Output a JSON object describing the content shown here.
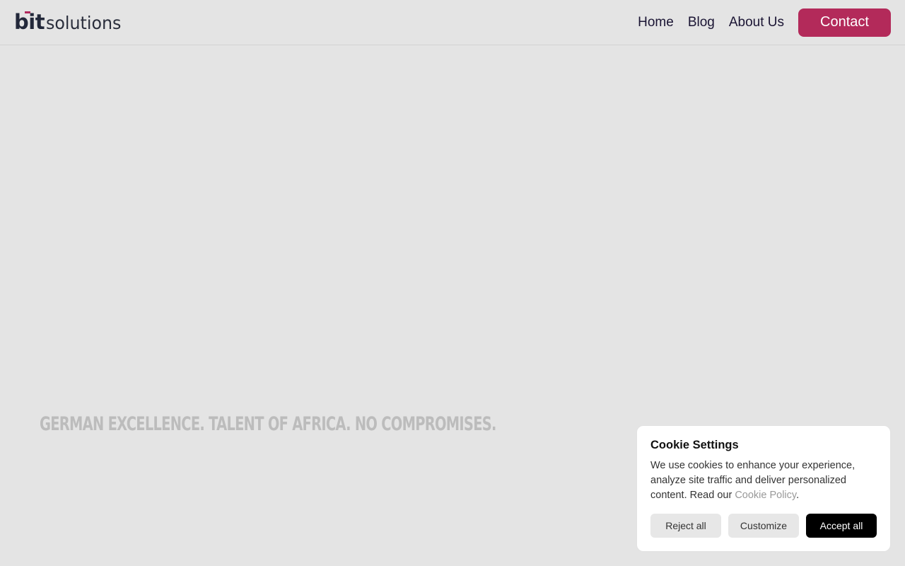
{
  "header": {
    "logo": {
      "bit": "bit",
      "solutions": "solutions"
    },
    "nav": [
      {
        "label": "Home"
      },
      {
        "label": "Blog"
      },
      {
        "label": "About Us"
      }
    ],
    "contact_label": "Contact"
  },
  "hero": {
    "tagline": "GERMAN EXCELLENCE. TALENT OF AFRICA. NO COMPROMISES."
  },
  "cookie": {
    "title": "Cookie Settings",
    "text_before": "We use cookies to enhance your experience, analyze site traffic and deliver personalized content. Read our ",
    "link_label": "Cookie Policy",
    "text_after": ".",
    "reject_label": "Reject all",
    "customize_label": "Customize",
    "accept_label": "Accept all"
  },
  "colors": {
    "background": "#e4e4e4",
    "accent": "#b32a5a",
    "nav_text": "#1a1433",
    "tagline": "#bcbcbc"
  }
}
